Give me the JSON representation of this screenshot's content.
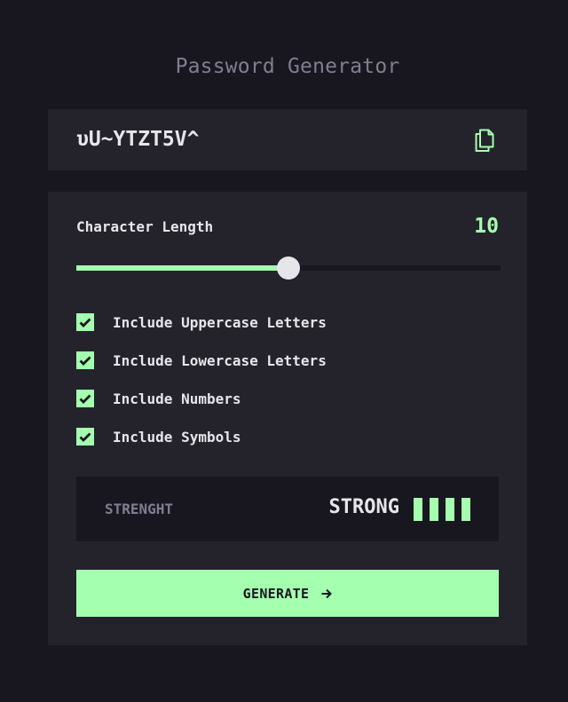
{
  "app": {
    "title": "Password Generator"
  },
  "password": {
    "value": "υU~YTZT5V^",
    "copy_icon": "copy-icon"
  },
  "length": {
    "label": "Character Length",
    "value": "10",
    "fraction": 0.5
  },
  "options": [
    {
      "label": "Include Uppercase Letters",
      "checked": true
    },
    {
      "label": "Include Lowercase Letters",
      "checked": true
    },
    {
      "label": "Include Numbers",
      "checked": true
    },
    {
      "label": "Include Symbols",
      "checked": true
    }
  ],
  "strength": {
    "label": "STRENGHT",
    "value": "STRONG",
    "bars_filled": 4,
    "bars_total": 4
  },
  "generate": {
    "label": "GENERATE",
    "icon": "arrow-right-icon"
  },
  "colors": {
    "background": "#18171f",
    "panel": "#24232c",
    "accent": "#a4ffaf",
    "text": "#e6e5ea",
    "muted": "#817d92"
  }
}
